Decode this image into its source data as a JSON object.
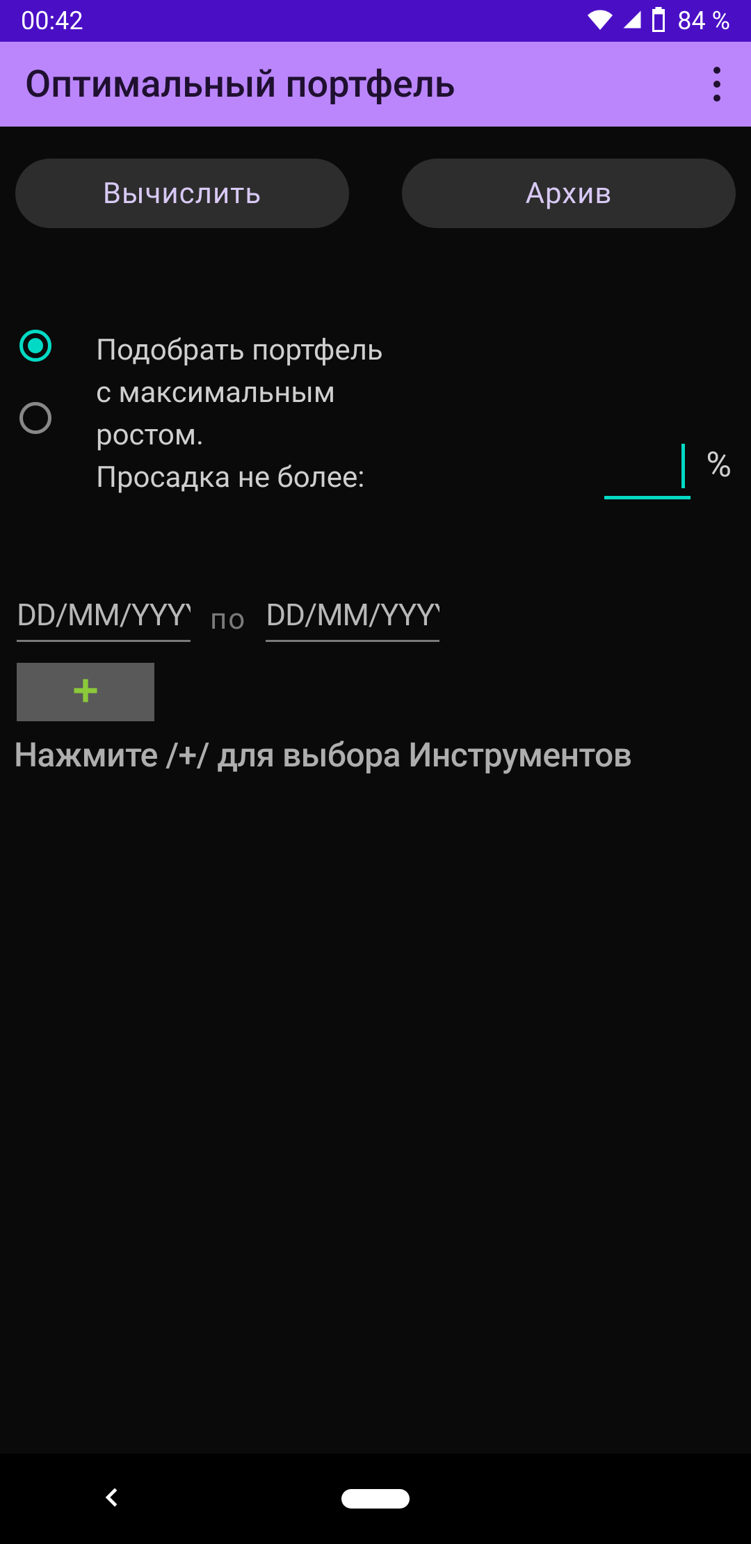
{
  "status": {
    "time": "00:42",
    "battery": "84 %"
  },
  "app_bar": {
    "title": "Оптимальный портфель"
  },
  "buttons": {
    "compute": "Вычислить",
    "archive": "Архив"
  },
  "radio": {
    "option1_line1": "Подобрать портфель",
    "option1_line2": "с максимальным",
    "option1_line3": "ростом.",
    "option1_line4": "Просадка не более:",
    "percent_sign": "%"
  },
  "dates": {
    "from_placeholder": "DD/MM/YYYY",
    "separator": "по",
    "to_placeholder": "DD/MM/YYYY"
  },
  "hint": "Нажмите /+/ для выбора Инструментов"
}
